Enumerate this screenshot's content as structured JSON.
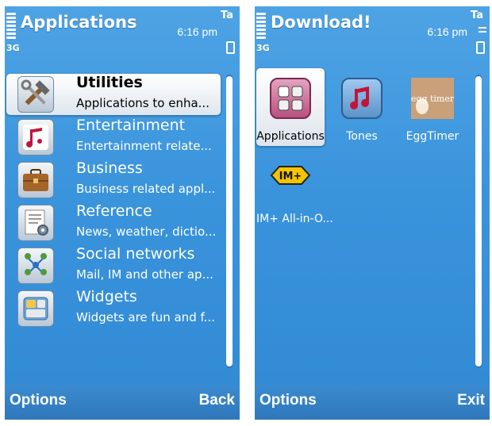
{
  "screens": [
    {
      "title": "Applications",
      "time": "6:16 pm",
      "network": "3G",
      "status_icon": "Ta",
      "items": [
        {
          "title": "Utilities",
          "subtitle": "Applications to enha...",
          "icon": "tools-icon",
          "selected": true
        },
        {
          "title": "Entertainment",
          "subtitle": "Entertainment relate...",
          "icon": "music-note-icon",
          "selected": false
        },
        {
          "title": "Business",
          "subtitle": "Business related appl...",
          "icon": "briefcase-icon",
          "selected": false
        },
        {
          "title": "Reference",
          "subtitle": "News, weather, dictio...",
          "icon": "document-gear-icon",
          "selected": false
        },
        {
          "title": "Social networks",
          "subtitle": "Mail, IM and other ap...",
          "icon": "people-network-icon",
          "selected": false
        },
        {
          "title": "Widgets",
          "subtitle": "Widgets are fun and f...",
          "icon": "widgets-icon",
          "selected": false
        }
      ],
      "softkeys": {
        "left": "Options",
        "right": "Back"
      }
    },
    {
      "title": "Download!",
      "time": "6:16 pm",
      "network": "3G",
      "status_icon": "Ta",
      "grid": [
        {
          "label": "Applications",
          "icon": "applications-folder-icon",
          "selected": true
        },
        {
          "label": "Tones",
          "icon": "music-note-icon",
          "selected": false
        },
        {
          "label": "EggTimer",
          "icon": "eggtimer-icon",
          "icon_text": "egg timer",
          "selected": false
        },
        {
          "label": "IM+ All-in-O...",
          "icon": "im-plus-icon",
          "icon_text": "IM+",
          "selected": false
        }
      ],
      "softkeys": {
        "left": "Options",
        "right": "Exit"
      }
    }
  ]
}
